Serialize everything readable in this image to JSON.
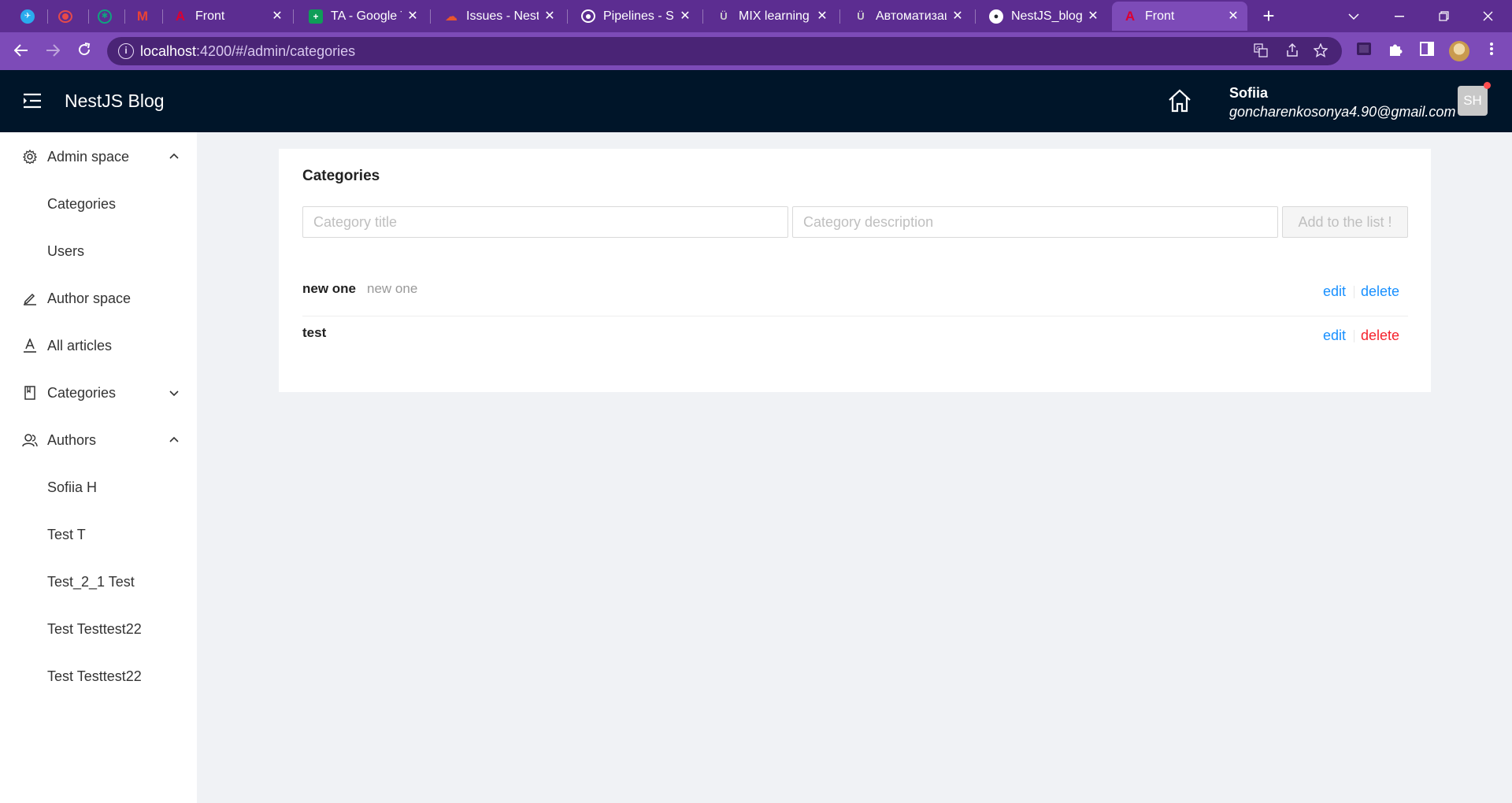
{
  "browser": {
    "tabs": [
      {
        "label": "",
        "favicon": "telegram-icon",
        "favicon_color": "#2aabee",
        "pinned": true
      },
      {
        "label": "",
        "favicon": "record-icon",
        "favicon_color": "#e64a4a",
        "pinned": true
      },
      {
        "label": "",
        "favicon": "chatgpt-icon",
        "favicon_color": "#10a37f",
        "pinned": true
      },
      {
        "label": "",
        "favicon": "gmail-icon",
        "favicon_color": "#ea4335",
        "pinned": true
      },
      {
        "label": "Front",
        "favicon": "angular-icon",
        "favicon_color": "#dd0031"
      },
      {
        "label": "TA - Google T",
        "favicon": "google-sheets-icon",
        "favicon_color": "#0f9d58"
      },
      {
        "label": "Issues - NestJ",
        "favicon": "cloud-icon",
        "favicon_color": "#e8552d"
      },
      {
        "label": "Pipelines - So",
        "favicon": "pipelines-icon",
        "favicon_color": "#ffffff"
      },
      {
        "label": "MIX learning",
        "favicon": "mix-icon",
        "favicon_color": "#cfcfcf"
      },
      {
        "label": "Автоматизац",
        "favicon": "mix-icon",
        "favicon_color": "#cfcfcf"
      },
      {
        "label": "NestJS_blog/",
        "favicon": "github-icon",
        "favicon_color": "#ffffff"
      },
      {
        "label": "Front",
        "favicon": "angular-icon",
        "favicon_color": "#dd0031",
        "active": true
      }
    ],
    "url_host": "localhost",
    "url_path": ":4200/#/admin/categories",
    "colors": {
      "tabstrip": "#5c2d91",
      "toolbar": "#7d4bb8"
    }
  },
  "header": {
    "brand": "NestJS Blog",
    "user_name": "Sofiia",
    "user_email": "goncharenkosonya4.90@gmail.com",
    "avatar_initials": "SH",
    "bg_color": "#001529"
  },
  "sidebar": {
    "items": [
      {
        "label": "Admin space",
        "icon": "gear-icon",
        "arrow": "up"
      },
      {
        "label": "Categories",
        "sub": true
      },
      {
        "label": "Users",
        "sub": true
      },
      {
        "label": "Author space",
        "icon": "pencil-icon"
      },
      {
        "label": "All articles",
        "icon": "font-icon"
      },
      {
        "label": "Categories",
        "icon": "book-icon",
        "arrow": "down"
      },
      {
        "label": "Authors",
        "icon": "users-icon",
        "arrow": "up"
      },
      {
        "label": "Sofiia H",
        "sub": true
      },
      {
        "label": "Test T",
        "sub": true
      },
      {
        "label": "Test_2_1 Test",
        "sub": true
      },
      {
        "label": "Test Testtest22",
        "sub": true
      },
      {
        "label": "Test Testtest22",
        "sub": true
      }
    ]
  },
  "main": {
    "title": "Categories",
    "title_placeholder": "Category title",
    "description_placeholder": "Category description",
    "add_button": "Add to the list !",
    "categories": [
      {
        "title": "new one",
        "description": "new one",
        "edit": "edit",
        "delete": "delete",
        "delete_color": "#1890ff"
      },
      {
        "title": "test",
        "description": "",
        "edit": "edit",
        "delete": "delete",
        "delete_color": "#f5222d"
      }
    ]
  }
}
